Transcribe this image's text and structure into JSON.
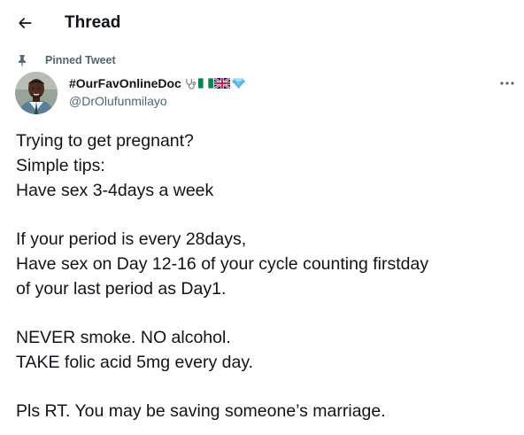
{
  "header": {
    "title": "Thread"
  },
  "pinned": {
    "label": "Pinned Tweet"
  },
  "author": {
    "display_name": "#OurFavOnlineDoc",
    "handle": "@DrOlufunmilayo",
    "badges": [
      "stethoscope-icon",
      "nigeria-flag-icon",
      "uk-flag-icon",
      "diamond-icon"
    ]
  },
  "tweet": {
    "paragraphs": [
      [
        "Trying to get pregnant?",
        "Simple tips:",
        "Have sex 3-4days a week"
      ],
      [
        "If your period is every 28days,",
        "Have sex on Day 12-16 of your cycle counting firstday",
        "of your last period as Day1."
      ],
      [
        "NEVER smoke. NO alcohol.",
        "TAKE folic acid 5mg every day."
      ],
      [
        "Pls RT. You may be saving someone’s marriage."
      ]
    ]
  },
  "colors": {
    "text_primary": "#0f1419",
    "text_secondary": "#536471",
    "background": "#ffffff"
  }
}
